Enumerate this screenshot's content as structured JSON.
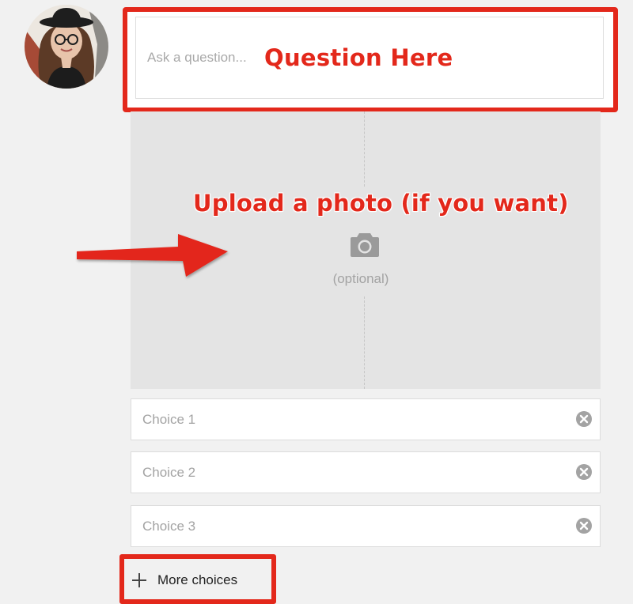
{
  "question": {
    "placeholder": "Ask a question...",
    "callout": "Question Here"
  },
  "photo": {
    "callout": "Upload a photo (if you want)",
    "optional_label": "(optional)",
    "icon": "camera-icon"
  },
  "choices": [
    {
      "placeholder": "Choice 1",
      "remove_icon": "remove-circle-icon"
    },
    {
      "placeholder": "Choice 2",
      "remove_icon": "remove-circle-icon"
    },
    {
      "placeholder": "Choice 3",
      "remove_icon": "remove-circle-icon"
    }
  ],
  "more_choices": {
    "label": "More choices",
    "icon": "plus-icon"
  },
  "colors": {
    "annotation_red": "#e3281b",
    "photo_area_bg": "#e4e4e4",
    "page_bg": "#f1f1f1"
  }
}
